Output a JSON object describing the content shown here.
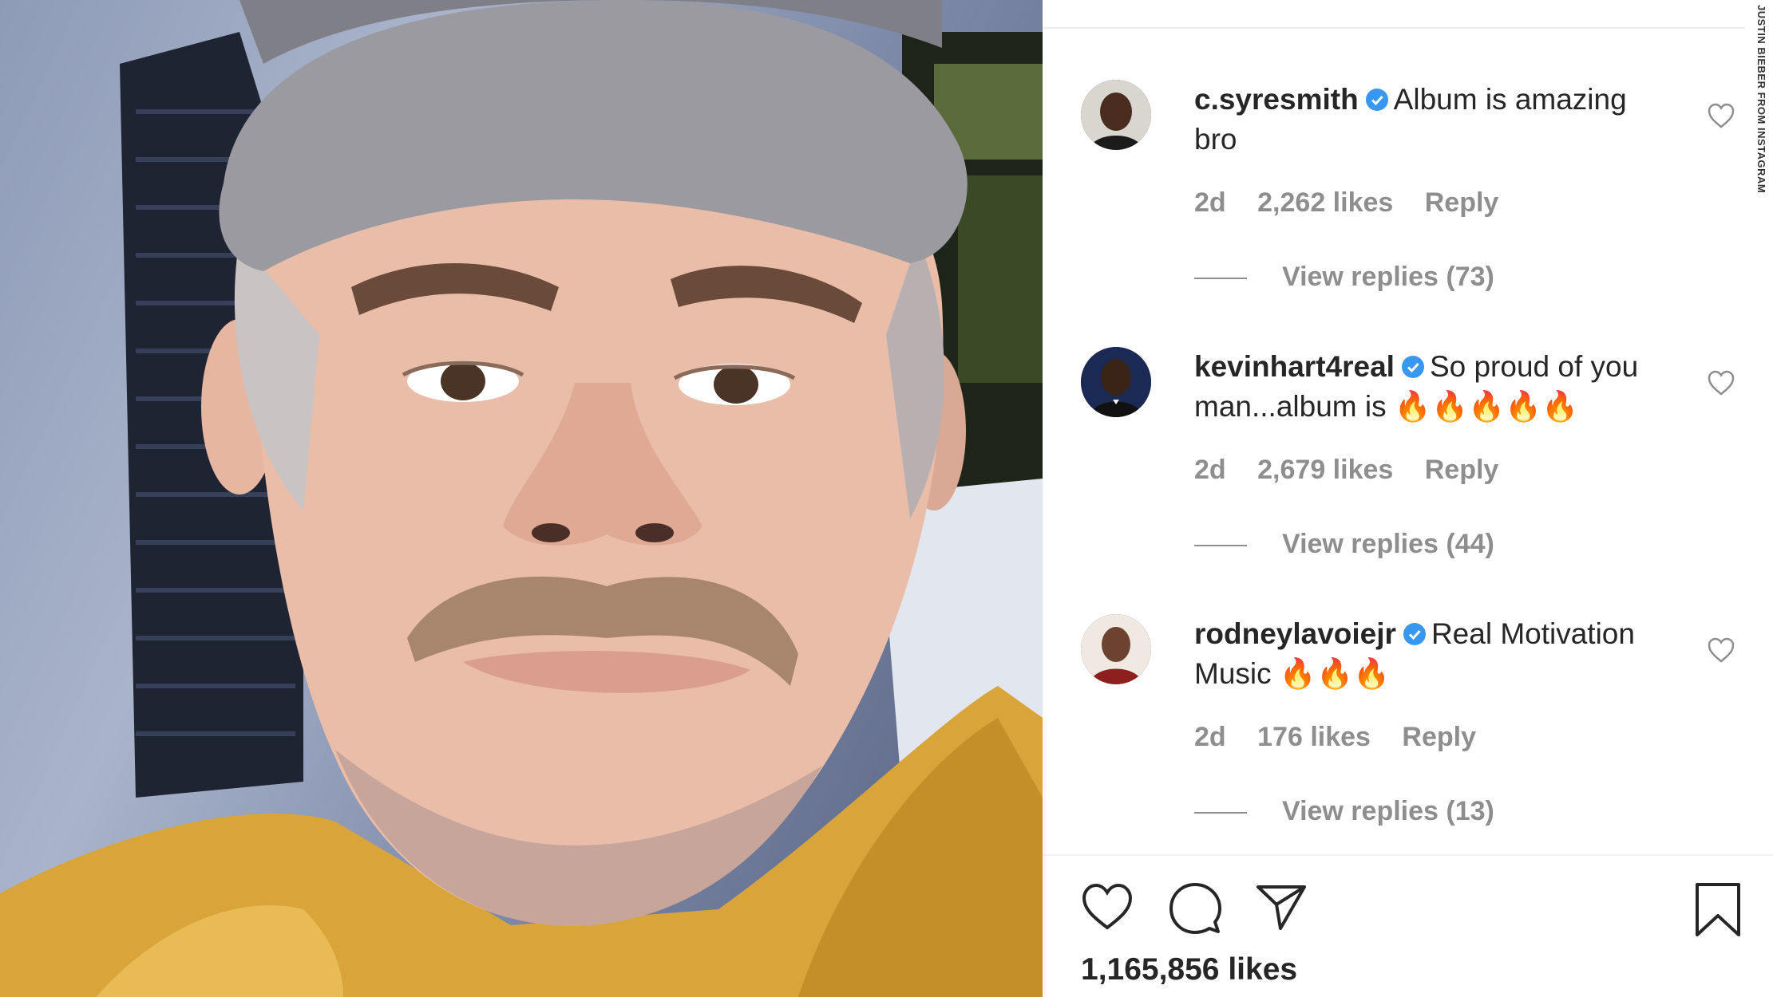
{
  "credit": "JUSTIN BIEBER FROM INSTAGRAM",
  "comments": [
    {
      "username": "c.syresmith",
      "text_line1": "Album is amazing",
      "text_line2": "bro",
      "age": "2d",
      "likes": "2,262 likes",
      "reply_label": "Reply",
      "view_replies": "View replies (73)"
    },
    {
      "username": "kevinhart4real",
      "text_line1": "So proud of you",
      "text_line2": "man...album is",
      "emoji": "🔥🔥🔥🔥🔥",
      "age": "2d",
      "likes": "2,679 likes",
      "reply_label": "Reply",
      "view_replies": "View replies (44)"
    },
    {
      "username": "rodneylavoiejr",
      "text_line1": "Real Motivation",
      "text_line2": "Music",
      "emoji": "🔥🔥🔥",
      "age": "2d",
      "likes": "176 likes",
      "reply_label": "Reply",
      "view_replies": "View replies (13)"
    }
  ],
  "post": {
    "likes_count": "1,165,856 likes"
  },
  "icons": {
    "like": "heart-icon",
    "comment": "comment-icon",
    "share": "paper-plane-icon",
    "save": "bookmark-icon",
    "verified": "verified-badge-icon",
    "comment_like": "heart-icon"
  },
  "colors": {
    "verified_blue": "#3897f0",
    "text": "#262626",
    "muted": "#8e8e8e",
    "hoodie": "#d9a53a",
    "cap": "#9a9aa0"
  }
}
